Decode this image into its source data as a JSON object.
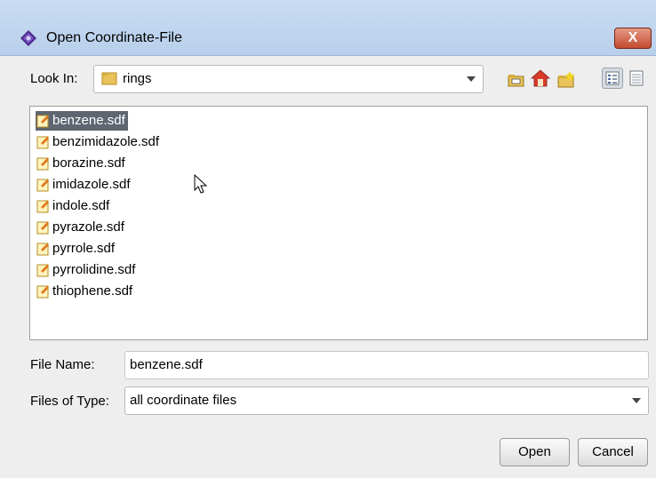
{
  "window": {
    "title": "Open Coordinate-File",
    "close_label": "X"
  },
  "look_in": {
    "label": "Look In:",
    "value": "rings",
    "icons": [
      "up-folder-icon",
      "home-icon",
      "new-folder-icon",
      "list-view-icon",
      "details-view-icon"
    ]
  },
  "files": [
    {
      "name": "benzene.sdf",
      "selected": true
    },
    {
      "name": "benzimidazole.sdf",
      "selected": false
    },
    {
      "name": "borazine.sdf",
      "selected": false
    },
    {
      "name": "imidazole.sdf",
      "selected": false
    },
    {
      "name": "indole.sdf",
      "selected": false
    },
    {
      "name": "pyrazole.sdf",
      "selected": false
    },
    {
      "name": "pyrrole.sdf",
      "selected": false
    },
    {
      "name": "pyrrolidine.sdf",
      "selected": false
    },
    {
      "name": "thiophene.sdf",
      "selected": false
    }
  ],
  "file_name": {
    "label": "File Name:",
    "value": "benzene.sdf"
  },
  "file_type": {
    "label": "Files of Type:",
    "value": "all coordinate files"
  },
  "buttons": {
    "open": "Open",
    "cancel": "Cancel"
  },
  "colors": {
    "selection": "#5f6670",
    "titlebar": "#c9dcf3",
    "close": "#c24a2f"
  }
}
